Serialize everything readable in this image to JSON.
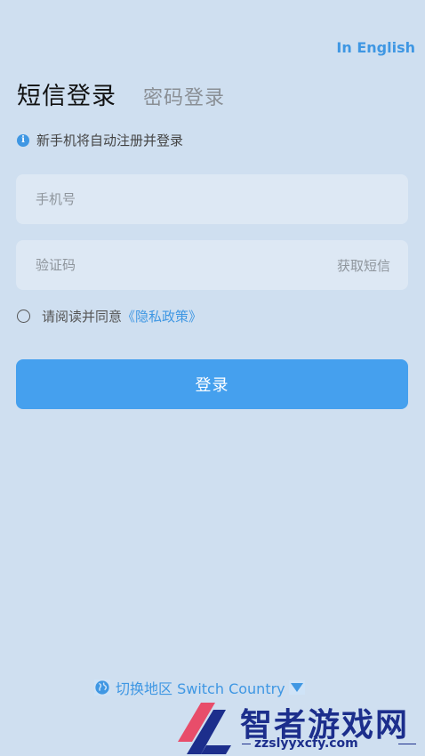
{
  "header": {
    "language_link": "In English"
  },
  "tabs": [
    {
      "label": "短信登录",
      "active": true
    },
    {
      "label": "密码登录",
      "active": false
    }
  ],
  "notice": {
    "icon": "info-icon",
    "text": "新手机将自动注册并登录"
  },
  "form": {
    "phone": {
      "placeholder": "手机号",
      "value": ""
    },
    "code": {
      "placeholder": "验证码",
      "value": "",
      "action_label": "获取短信"
    },
    "agreement": {
      "prefix": "请阅读并同意",
      "link": "《隐私政策》",
      "checked": false
    },
    "submit_label": "登录"
  },
  "footer": {
    "region_label": "切换地区 Switch Country",
    "icons": [
      "globe-icon",
      "triangle-down-icon"
    ]
  },
  "watermark": {
    "title": "智者游戏网",
    "url": "zzslyyxcfy.com"
  },
  "colors": {
    "accent": "#3f97e3",
    "button": "#45a0ee",
    "background": "#cfdff0",
    "field": "#dde8f4"
  }
}
